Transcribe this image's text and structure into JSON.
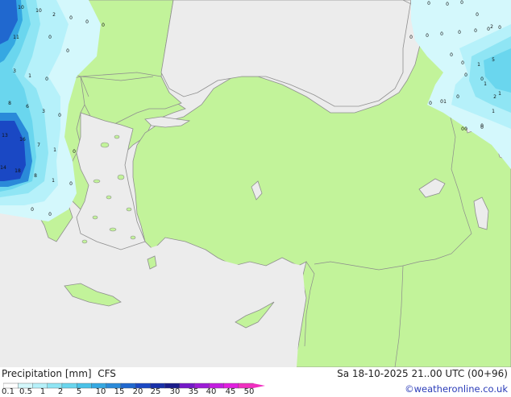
{
  "product": "Precipitation [mm]",
  "model": "CFS",
  "valid_time": "Sa 18-10-2025 21..00 UTC (00+96)",
  "credit": "©weatheronline.co.uk",
  "colors": {
    "sea": "#ececec",
    "land": "#c2f39a",
    "coast": "#8f8f8f",
    "border": "#8c8c8c",
    "precip_scale": [
      "#ffffff",
      "#d4f8fc",
      "#b6f1fa",
      "#8fe5f4",
      "#6ad6ee",
      "#4ac2e8",
      "#35a8e2",
      "#2a8ad9",
      "#2068cf",
      "#1a48c4",
      "#1830a8",
      "#1a1c8a",
      "#7418c8",
      "#9c1bd6",
      "#c21de0",
      "#e11fe0",
      "#f02fc0"
    ]
  },
  "legend": {
    "ticks": [
      "0.1",
      "0.5",
      "1",
      "2",
      "5",
      "10",
      "15",
      "20",
      "25",
      "30",
      "35",
      "40",
      "45",
      "50"
    ]
  },
  "grid_values": [
    {
      "t": "10"
    },
    {
      "t": "10"
    },
    {
      "t": "2"
    },
    {
      "t": "0"
    },
    {
      "t": "0"
    },
    {
      "t": "0"
    },
    {
      "t": "0"
    },
    {
      "t": "0"
    },
    {
      "t": "0"
    },
    {
      "t": "11"
    },
    {
      "t": "0"
    },
    {
      "t": "0"
    },
    {
      "t": "3"
    },
    {
      "t": "1"
    },
    {
      "t": "0"
    },
    {
      "t": "8"
    },
    {
      "t": "6"
    },
    {
      "t": "3"
    },
    {
      "t": "0"
    },
    {
      "t": "13"
    },
    {
      "t": "16"
    },
    {
      "t": "7"
    },
    {
      "t": "1"
    },
    {
      "t": "0"
    },
    {
      "t": "14"
    },
    {
      "t": "18"
    },
    {
      "t": "8"
    },
    {
      "t": "1"
    },
    {
      "t": "0"
    },
    {
      "t": "0"
    },
    {
      "t": "0"
    },
    {
      "t": "0"
    },
    {
      "t": "0"
    },
    {
      "t": "0"
    },
    {
      "t": "0"
    },
    {
      "t": "0"
    },
    {
      "t": "0"
    },
    {
      "t": "0"
    },
    {
      "t": "2"
    },
    {
      "t": "0"
    },
    {
      "t": "0"
    },
    {
      "t": "0"
    },
    {
      "t": "0"
    },
    {
      "t": "0"
    },
    {
      "t": "0"
    },
    {
      "t": "0"
    },
    {
      "t": "0"
    },
    {
      "t": "1"
    },
    {
      "t": "5"
    },
    {
      "t": "0"
    },
    {
      "t": "1"
    },
    {
      "t": "1"
    },
    {
      "t": "1"
    },
    {
      "t": "2"
    },
    {
      "t": "0"
    },
    {
      "t": "1"
    },
    {
      "t": "0"
    },
    {
      "t": "0"
    }
  ]
}
